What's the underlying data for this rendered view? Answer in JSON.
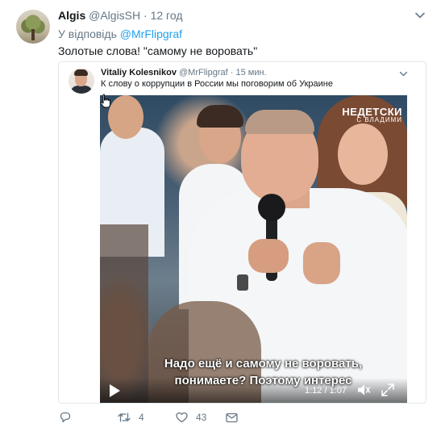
{
  "tweet": {
    "author_name": "Algis",
    "author_handle": "@AlgisSH",
    "separator": "·",
    "time": "12 год",
    "reply_prefix": "У відповідь",
    "reply_mention": "@MrFlipgraf",
    "text": "Золотые слова! \"самому не воровать\"",
    "avatar_icon": "avatar-tree-photo",
    "menu_icon": "chevron-down-icon"
  },
  "quoted": {
    "author_name": "Vitaliy Kolesnikov",
    "author_handle": "@MrFlipgraf",
    "separator": "·",
    "time": "15 мин.",
    "text": "К слову о коррупции в России мы поговорим об Украине",
    "menu_icon": "chevron-down-icon",
    "video": {
      "channel_logo_top": "НЕДЕТСКИ",
      "channel_logo_bottom": "С ВЛАДИМИ",
      "subtitle_line1": "Надо ещё и самому не воровать,",
      "subtitle_line2": "понимаете? Поэтому интерес",
      "time_readout": "1:12 / 1:07",
      "controls": [
        "play-icon",
        "volume-icon",
        "fullscreen-icon"
      ]
    }
  },
  "actions": {
    "reply_count": "",
    "retweet_count": "4",
    "like_count": "43",
    "icons": [
      "reply-icon",
      "retweet-icon",
      "like-icon",
      "message-icon"
    ]
  },
  "colors": {
    "link": "#1da1f2",
    "secondary_text": "#657786",
    "border": "#e1e8ed",
    "primary_text": "#14171a"
  }
}
